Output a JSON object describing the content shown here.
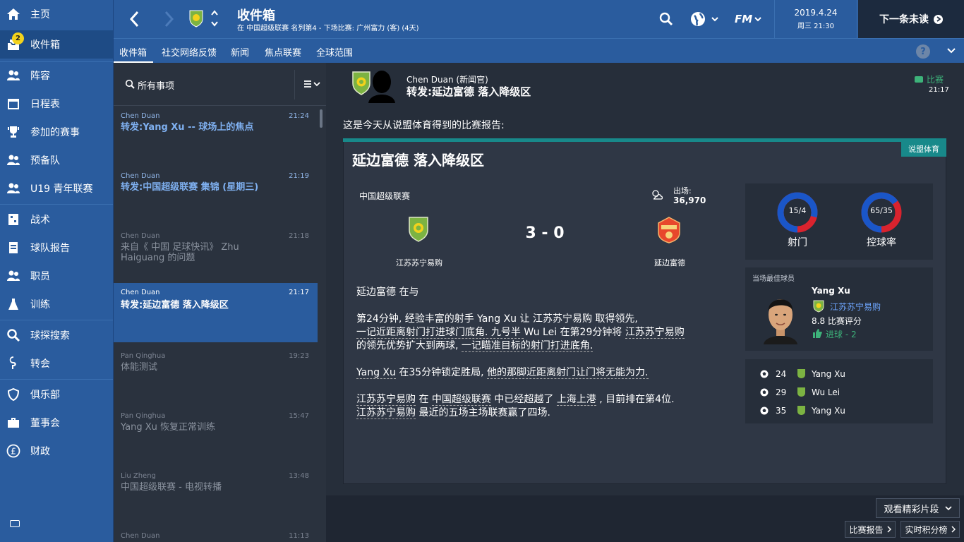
{
  "sidebar": {
    "items": [
      {
        "label": "主页",
        "icon": "home-icon"
      },
      {
        "label": "收件箱",
        "icon": "inbox-icon",
        "badge": "2"
      },
      {
        "label": "阵容",
        "icon": "squad-icon"
      },
      {
        "label": "日程表",
        "icon": "calendar-icon"
      },
      {
        "label": "参加的赛事",
        "icon": "trophy-icon"
      },
      {
        "label": "预备队",
        "icon": "reserves-icon"
      },
      {
        "label": "U19 青年联赛",
        "icon": "youth-icon"
      },
      {
        "label": "战术",
        "icon": "tactics-icon"
      },
      {
        "label": "球队报告",
        "icon": "report-icon"
      },
      {
        "label": "职员",
        "icon": "staff-icon"
      },
      {
        "label": "训练",
        "icon": "training-icon"
      },
      {
        "label": "球探搜索",
        "icon": "search-icon"
      },
      {
        "label": "转会",
        "icon": "transfer-icon"
      },
      {
        "label": "俱乐部",
        "icon": "shield-icon"
      },
      {
        "label": "董事会",
        "icon": "briefcase-icon"
      },
      {
        "label": "财政",
        "icon": "pound-icon"
      }
    ]
  },
  "header": {
    "title": "收件箱",
    "subtitle": "在 中国超级联赛 名列第4 - 下场比赛: 广州富力 (客) (4天)",
    "date": "2019.4.24",
    "time": "周三 21:30",
    "next_label": "下一条未读",
    "fm_label": "FM"
  },
  "subtabs": [
    "收件箱",
    "社交网络反馈",
    "新闻",
    "焦点联赛",
    "全球范围"
  ],
  "search": {
    "label": "所有事项"
  },
  "messages": [
    {
      "from": "Chen Duan",
      "time": "21:24",
      "subject": "转发:Yang Xu -- 球场上的焦点",
      "unread": true
    },
    {
      "from": "Chen Duan",
      "time": "21:19",
      "subject": "转发:中国超级联赛 集锦 (星期三)",
      "unread": true
    },
    {
      "from": "Chen Duan",
      "time": "21:18",
      "subject": "来自《 中国 足球快讯》 Zhu Haiguang 的问题",
      "unread": false
    },
    {
      "from": "Chen Duan",
      "time": "21:17",
      "subject": "转发:延边富德 落入降级区",
      "unread": true,
      "selected": true
    },
    {
      "from": "Pan Qinghua",
      "time": "19:23",
      "subject": "体能测试",
      "unread": false
    },
    {
      "from": "Pan Qinghua",
      "time": "15:47",
      "subject": "Yang Xu 恢复正常训练",
      "unread": false
    },
    {
      "from": "Liu Zheng",
      "time": "13:48",
      "subject": "中国超级联赛 - 电视转播",
      "unread": false
    },
    {
      "from": "Chen Duan",
      "time": "11:13",
      "subject": "",
      "unread": false
    }
  ],
  "article": {
    "sender": "Chen Duan (新闻官)",
    "title": "转发:延边富德 落入降级区",
    "category": "比赛",
    "time": "21:17",
    "intro": "这是今天从说盟体育得到的比赛报告:",
    "source_tag": "说盟体育",
    "headline": "延边富德 落入降级区"
  },
  "match": {
    "competition": "中国超级联赛",
    "attendance_label": "出场:",
    "attendance": "36,970",
    "score": "3 - 0",
    "home": "江苏苏宁易购",
    "away": "延边富德"
  },
  "report_text": {
    "p1": "延边富德 在与",
    "p2a_1": "第24分钟, 经验丰富的射手 ",
    "p2a_player": "Yang Xu",
    "p2a_2": " 让 ",
    "p2a_team": "江苏苏宁易购",
    "p2a_3": " 取得领先,",
    "p2b_1": "一记近距离射门打进球门底角. 九号半 ",
    "p2b_player": "Wu Lei",
    "p2b_2": " 在第29分钟将 ",
    "p2b_team": "江苏苏宁易购",
    "p2c_1": "的领先优势扩大到两球, ",
    "p2c_2": "一记瞄准目标的射门打进底角.",
    "p3_player": "Yang Xu",
    "p3_1": " 在35分钟锁定胜局, ",
    "p3_2": "他的那脚近距离射门让门将无能为力.",
    "p4_team1": "江苏苏宁易购",
    "p4_1": " 在 ",
    "p4_comp": "中国超级联赛",
    "p4_2": " 中已经超越了 ",
    "p4_team2": "上海上港",
    "p4_3": " , 目前排在第4位.",
    "p5_team": "江苏苏宁易购",
    "p5_1": " 最近的五场主场联赛赢了四场."
  },
  "stats": {
    "shots_value": "15/4",
    "shots_label": "射门",
    "shots_home_fraction": 0.79,
    "possession_value": "65/35",
    "possession_label": "控球率",
    "possession_home_fraction": 0.65,
    "home_color": "#1a56c8",
    "away_color": "#d9232e"
  },
  "motm": {
    "header": "当场最佳球员",
    "name": "Yang Xu",
    "team": "江苏苏宁易购",
    "rating": "8.8 比赛评分",
    "goals": "进球 - 2"
  },
  "goals": [
    {
      "minute": "24",
      "player": "Yang Xu"
    },
    {
      "minute": "29",
      "player": "Wu Lei"
    },
    {
      "minute": "35",
      "player": "Yang Xu"
    }
  ],
  "footer": {
    "highlights": "观看精彩片段",
    "match_report": "比赛报告",
    "live_table": "实时积分榜"
  }
}
